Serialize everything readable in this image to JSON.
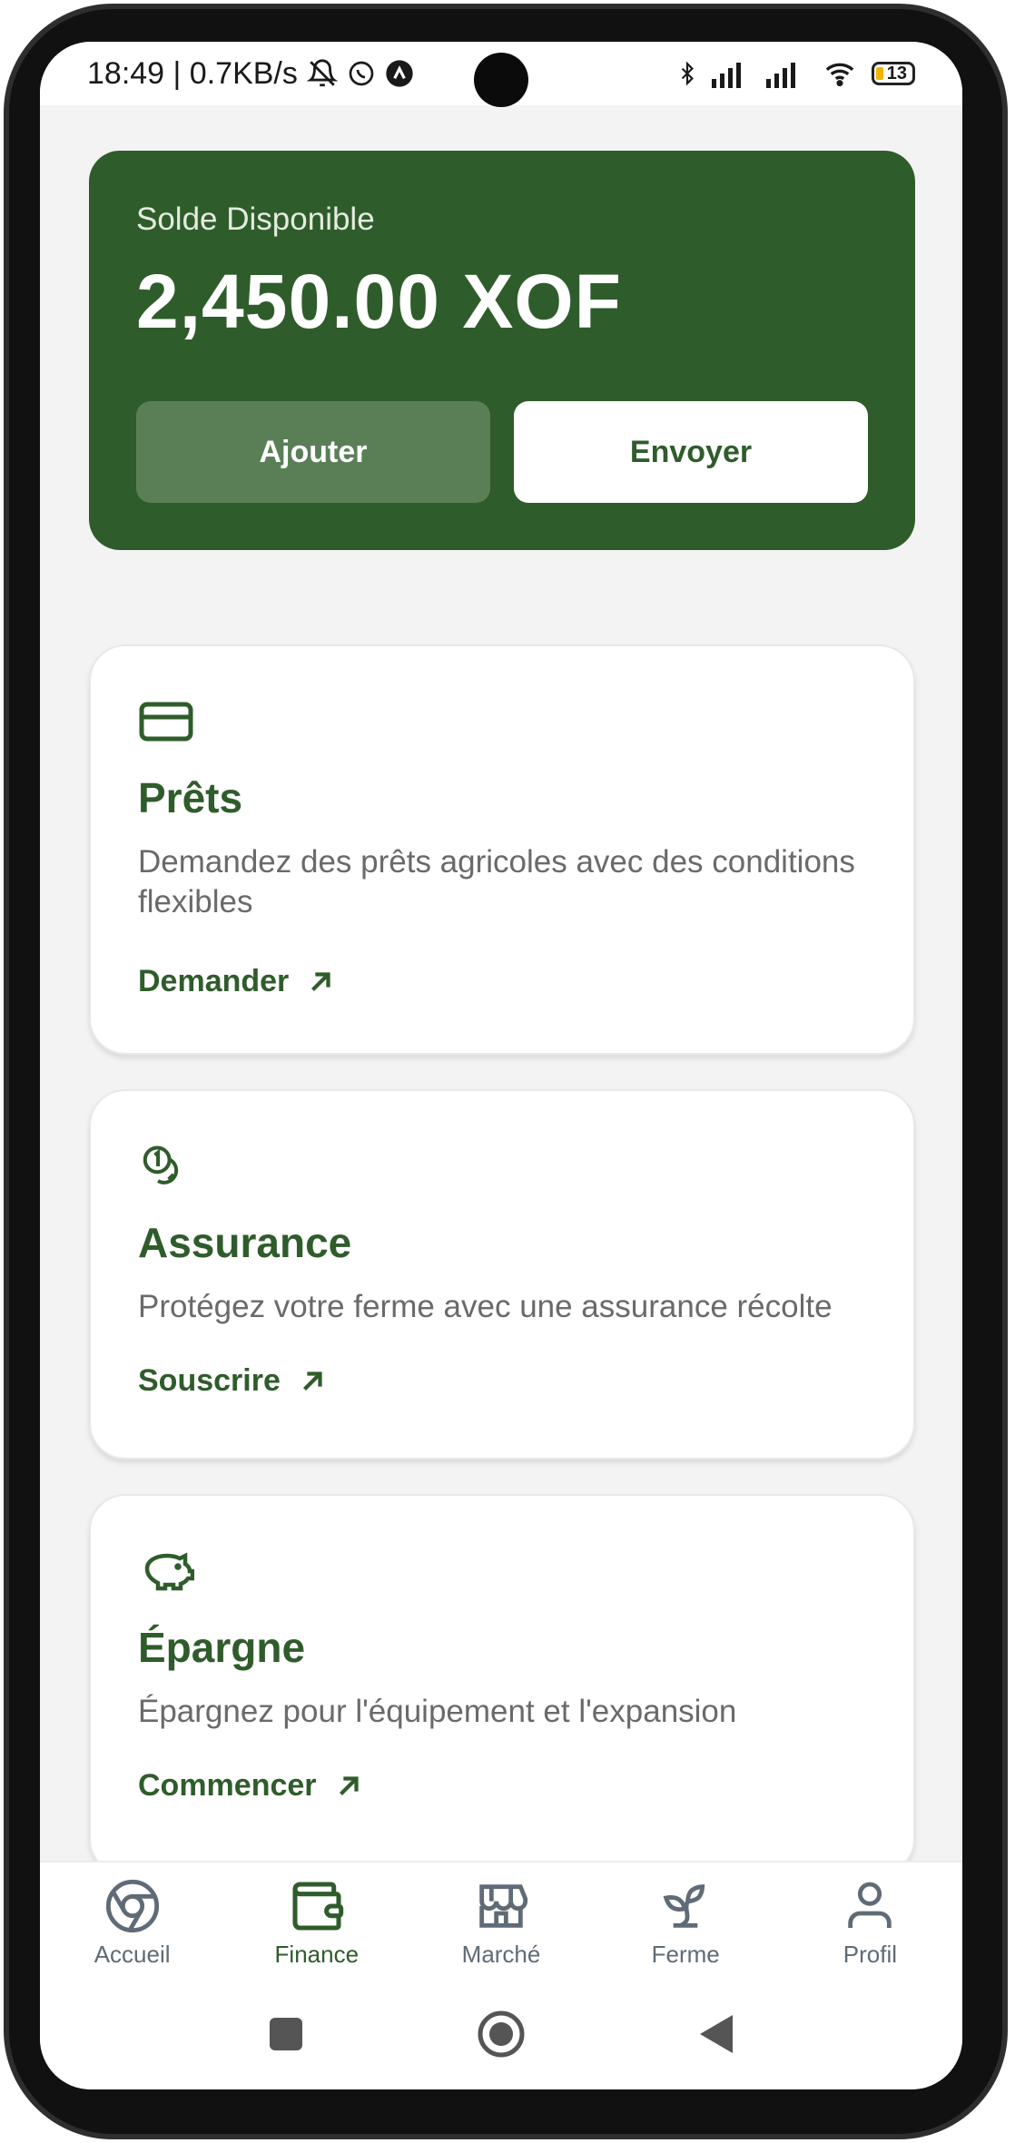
{
  "status_bar": {
    "time_speed": "18:49 | 0.7KB/s",
    "battery_level": "13"
  },
  "balance": {
    "label": "Solde Disponible",
    "amount": "2,450.00 XOF",
    "add_label": "Ajouter",
    "send_label": "Envoyer"
  },
  "services": [
    {
      "icon": "credit-card-icon",
      "title": "Prêts",
      "description": "Demandez des prêts agricoles avec des conditions flexibles",
      "action": "Demander"
    },
    {
      "icon": "coins-icon",
      "title": "Assurance",
      "description": "Protégez votre ferme avec une assurance récolte",
      "action": "Souscrire"
    },
    {
      "icon": "piggy-bank-icon",
      "title": "Épargne",
      "description": "Épargnez pour l'équipement et l'expansion",
      "action": "Commencer"
    }
  ],
  "bottom_nav": {
    "active": "Finance",
    "items": [
      {
        "label": "Accueil",
        "icon": "chrome-icon"
      },
      {
        "label": "Finance",
        "icon": "wallet-icon"
      },
      {
        "label": "Marché",
        "icon": "store-icon"
      },
      {
        "label": "Ferme",
        "icon": "sprout-icon"
      },
      {
        "label": "Profil",
        "icon": "user-icon"
      }
    ]
  },
  "colors": {
    "primary": "#2f5c2b",
    "button_add": "#5a7f57",
    "background": "#f3f3f3",
    "inactive_nav": "#5f6b76"
  }
}
